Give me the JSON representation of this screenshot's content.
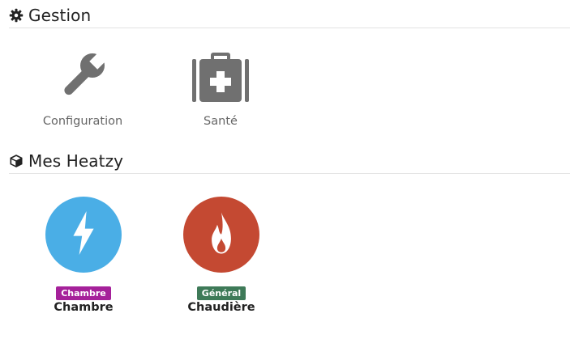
{
  "gestion": {
    "title": "Gestion",
    "header_icon": "gear-icon",
    "items": [
      {
        "label": "Configuration",
        "icon": "wrench-icon"
      },
      {
        "label": "Santé",
        "icon": "medical-kit-icon"
      }
    ]
  },
  "heatzy": {
    "title": "Mes Heatzy",
    "header_icon": "cube-icon",
    "devices": [
      {
        "badge": "Chambre",
        "name": "Chambre",
        "icon": "bolt-icon",
        "circle_color": "#4aaee6",
        "badge_color": "#a5219a"
      },
      {
        "badge": "Général",
        "name": "Chaudière",
        "icon": "flame-icon",
        "circle_color": "#c44932",
        "badge_color": "#3e7a58"
      }
    ]
  }
}
